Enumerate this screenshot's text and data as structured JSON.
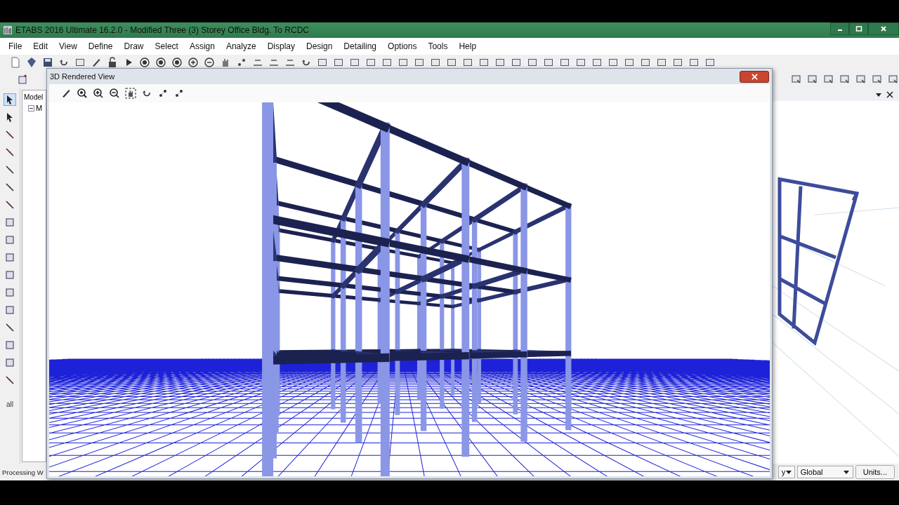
{
  "window": {
    "title": "ETABS 2016 Ultimate 16.2.0 - Modified Three (3) Storey Office Bldg. To RCDC"
  },
  "menu": [
    "File",
    "Edit",
    "View",
    "Define",
    "Draw",
    "Select",
    "Assign",
    "Analyze",
    "Display",
    "Design",
    "Detailing",
    "Options",
    "Tools",
    "Help"
  ],
  "explorer": {
    "tab": "Model",
    "root": "M"
  },
  "left_toolbar": {
    "select_label": "all"
  },
  "rendered_view": {
    "title": "3D Rendered View"
  },
  "status_bar": {
    "message": "Processing W",
    "cut_dropdown": "y",
    "coordinate_system": "Global",
    "units_button": "Units..."
  }
}
